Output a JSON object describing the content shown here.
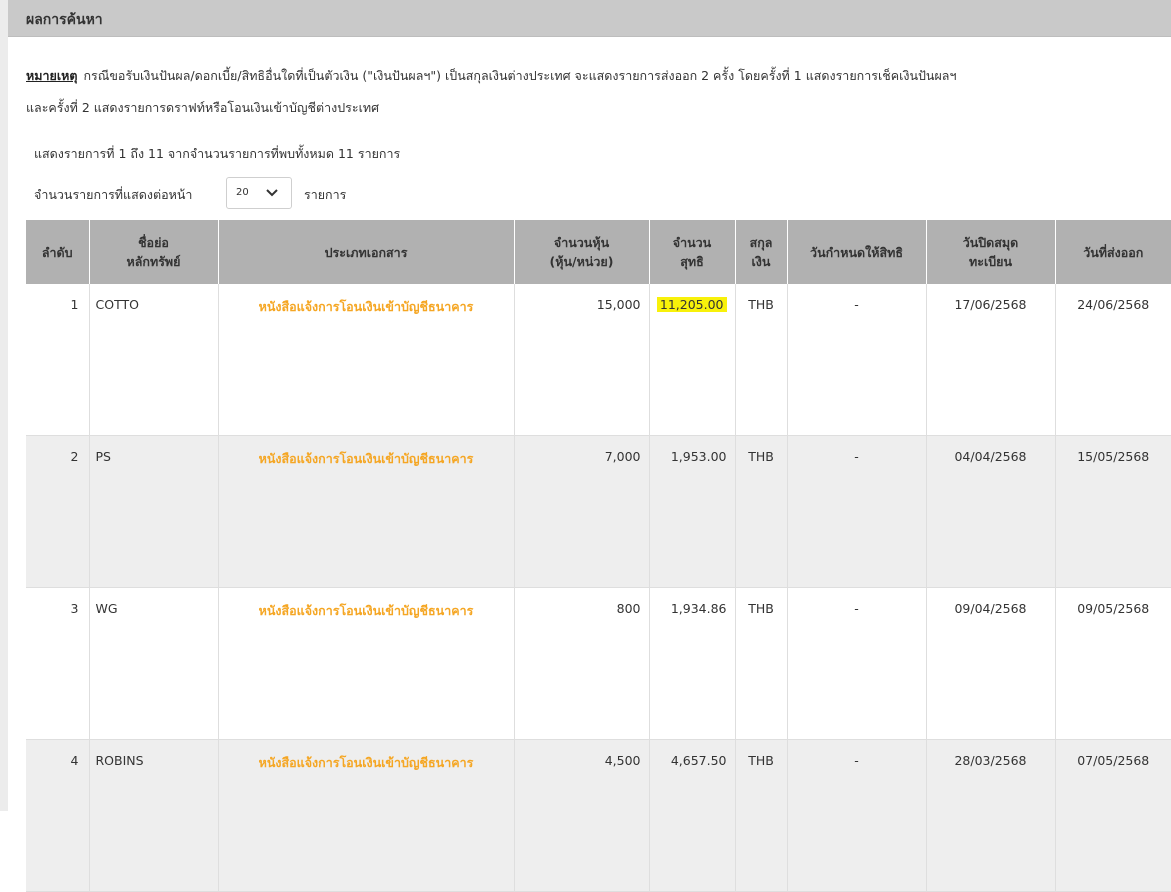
{
  "header": {
    "title": "ผลการค้นหา"
  },
  "note": {
    "label": "หมายเหตุ",
    "line1": "กรณีขอรับเงินปันผล/ดอกเบี้ย/สิทธิอื่นใดที่เป็นตัวเงิน (\"เงินปันผลฯ\") เป็นสกุลเงินต่างประเทศ จะแสดงรายการส่งออก 2 ครั้ง โดยครั้งที่ 1 แสดงรายการเช็คเงินปันผลฯ",
    "line2": "และครั้งที่ 2 แสดงรายการดราฟท์หรือโอนเงินเข้าบัญชีต่างประเทศ"
  },
  "summary": "แสดงรายการที่ 1 ถึง 11 จากจำนวนรายการที่พบทั้งหมด 11 รายการ",
  "pager": {
    "label": "จำนวนรายการที่แสดงต่อหน้า",
    "value": "20",
    "suffix": "รายการ"
  },
  "table": {
    "headers": {
      "no": "ลำดับ",
      "symbol1": "ชื่อย่อ",
      "symbol2": "หลักทรัพย์",
      "doc": "ประเภทเอกสาร",
      "shares1": "จำนวนหุ้น",
      "shares2": "(หุ้น/หน่วย)",
      "net1": "จำนวน",
      "net2": "สุทธิ",
      "cur1": "สกุล",
      "cur2": "เงิน",
      "rights": "วันกำหนดให้สิทธิ",
      "book1": "วันปิดสมุด",
      "book2": "ทะเบียน",
      "sent": "วันที่ส่งออก"
    },
    "rows": [
      {
        "no": "1",
        "symbol": "COTTO",
        "doc": "หนังสือแจ้งการโอนเงินเข้าบัญชีธนาคาร",
        "shares": "15,000",
        "net": "11,205.00",
        "currency": "THB",
        "rights": "-",
        "book": "17/06/2568",
        "sent": "24/06/2568"
      },
      {
        "no": "2",
        "symbol": "PS",
        "doc": "หนังสือแจ้งการโอนเงินเข้าบัญชีธนาคาร",
        "shares": "7,000",
        "net": "1,953.00",
        "currency": "THB",
        "rights": "-",
        "book": "04/04/2568",
        "sent": "15/05/2568"
      },
      {
        "no": "3",
        "symbol": "WG",
        "doc": "หนังสือแจ้งการโอนเงินเข้าบัญชีธนาคาร",
        "shares": "800",
        "net": "1,934.86",
        "currency": "THB",
        "rights": "-",
        "book": "09/04/2568",
        "sent": "09/05/2568"
      },
      {
        "no": "4",
        "symbol": "ROBINS",
        "doc": "หนังสือแจ้งการโอนเงินเข้าบัญชีธนาคาร",
        "shares": "4,500",
        "net": "4,657.50",
        "currency": "THB",
        "rights": "-",
        "book": "28/03/2568",
        "sent": "07/05/2568"
      }
    ]
  },
  "colors": {
    "link": "#f5a623",
    "highlight": "#f8f10a",
    "header_bg": "#b1b1b1",
    "title_bar": "#c9c9c9"
  },
  "icons": {
    "select_chevron": "chevron-down-icon"
  }
}
